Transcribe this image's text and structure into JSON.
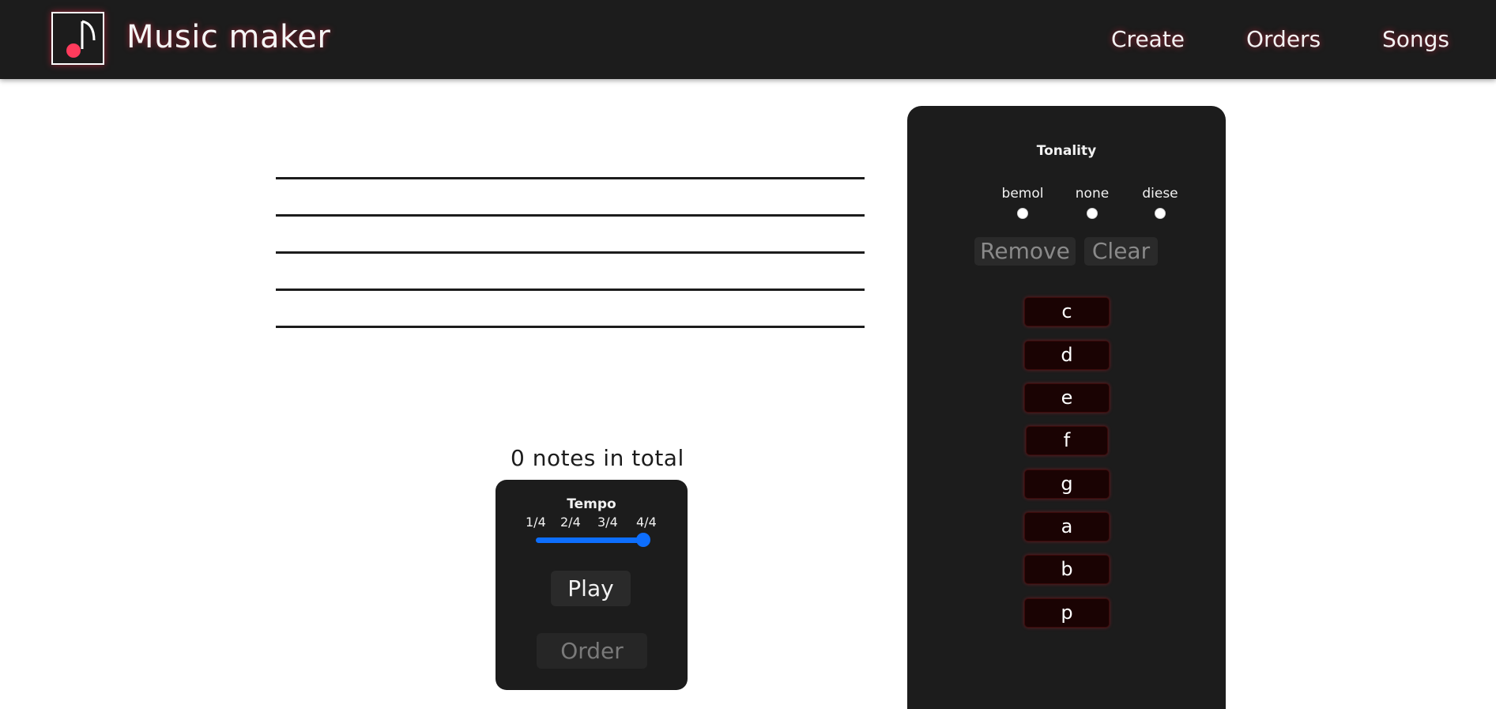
{
  "header": {
    "title": "Music maker",
    "logo_icon": "music-note-icon",
    "nav": [
      "Create",
      "Orders",
      "Songs"
    ]
  },
  "staff": {
    "line_count": 5
  },
  "notes_count_label": "0 notes in total",
  "playback": {
    "tempo_title": "Tempo",
    "tempo_ticks": [
      "1/4",
      "2/4",
      "3/4",
      "4/4"
    ],
    "tempo_selected": "4/4",
    "play_label": "Play",
    "order_label": "Order"
  },
  "notes_panel": {
    "tonality_title": "Tonality",
    "tonality_options": [
      "bemol",
      "none",
      "diese"
    ],
    "remove_label": "Remove",
    "clear_label": "Clear",
    "notes": [
      "c",
      "d",
      "e",
      "f",
      "g",
      "a",
      "b",
      "p"
    ]
  },
  "colors": {
    "header_bg": "#1c1c1c",
    "accent_glow": "#ff2846",
    "slider": "#0d6efd",
    "note_key_bg": "#1a0303"
  }
}
